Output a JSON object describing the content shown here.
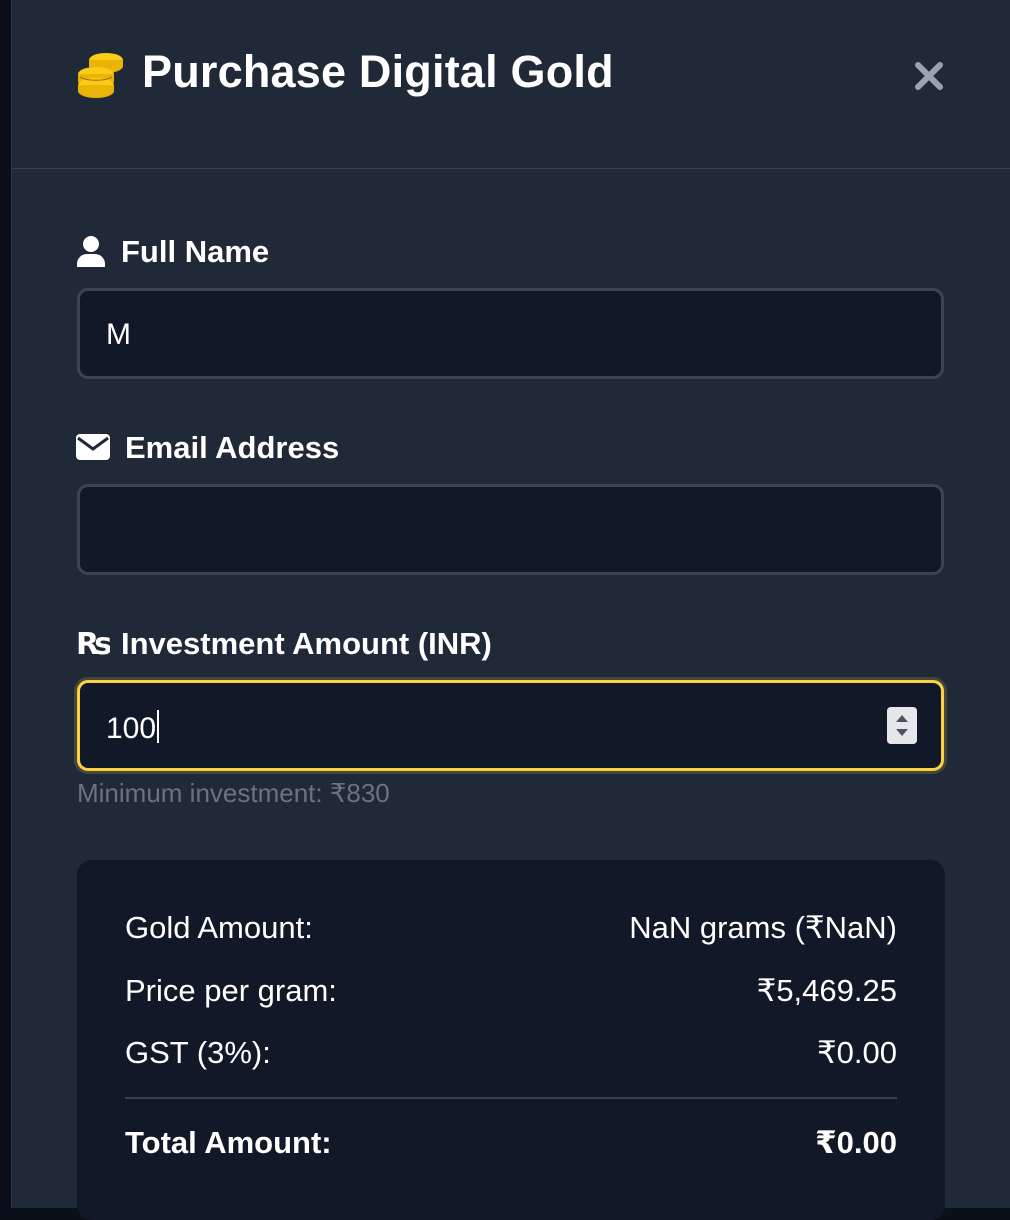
{
  "header": {
    "title": "Purchase Digital Gold",
    "close_label": "×"
  },
  "form": {
    "full_name": {
      "label": "Full Name",
      "value": "M"
    },
    "email": {
      "label": "Email Address",
      "value": ""
    },
    "investment": {
      "label": "Investment Amount (INR)",
      "value": "100",
      "hint": "Minimum investment: ₹830"
    }
  },
  "summary": {
    "rows": [
      {
        "label": "Gold Amount:",
        "value": "NaN grams (₹NaN)"
      },
      {
        "label": "Price per gram:",
        "value": "₹5,469.25"
      },
      {
        "label": "GST (3%):",
        "value": "₹0.00"
      }
    ],
    "total": {
      "label": "Total Amount:",
      "value": "₹0.00"
    }
  },
  "colors": {
    "accent": "#fbd243",
    "panel": "#1f2937",
    "input_bg": "#111827",
    "hint": "#6b7280"
  },
  "icons": [
    "coins-icon",
    "close-icon",
    "user-icon",
    "envelope-icon",
    "rupee-icon",
    "spinner-icon"
  ]
}
